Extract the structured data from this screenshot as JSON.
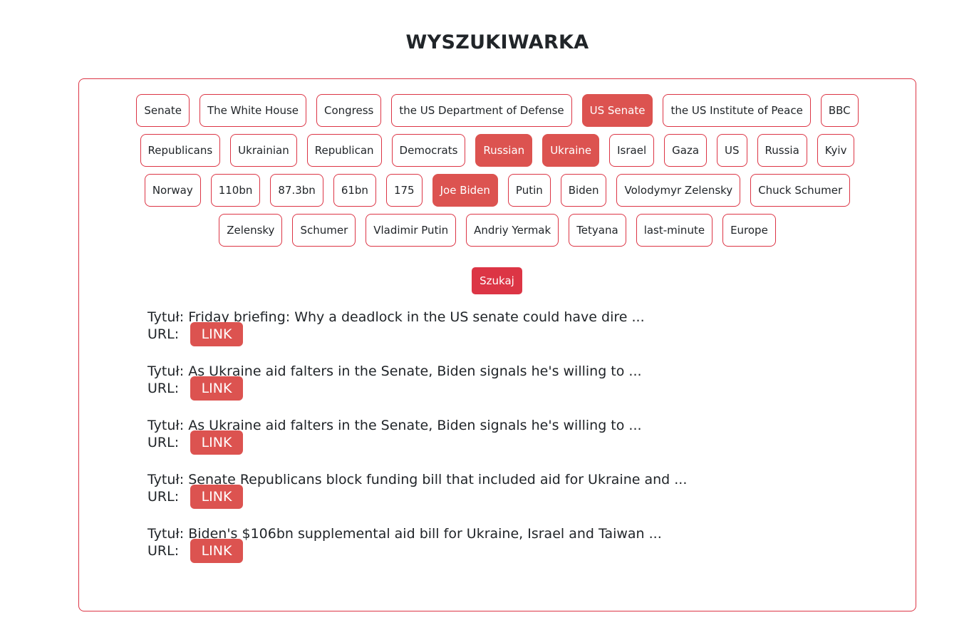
{
  "header": {
    "title": "WYSZUKIWARKA"
  },
  "tag_rows": [
    [
      {
        "label": "Senate",
        "active": false
      },
      {
        "label": "The White House",
        "active": false
      },
      {
        "label": "Congress",
        "active": false
      },
      {
        "label": "the US Department of Defense",
        "active": false
      },
      {
        "label": "US Senate",
        "active": true
      },
      {
        "label": "the US Institute of Peace",
        "active": false
      },
      {
        "label": "BBC",
        "active": false
      }
    ],
    [
      {
        "label": "Republicans",
        "active": false
      },
      {
        "label": "Ukrainian",
        "active": false
      },
      {
        "label": "Republican",
        "active": false
      },
      {
        "label": "Democrats",
        "active": false
      },
      {
        "label": "Russian",
        "active": true
      },
      {
        "label": "Ukraine",
        "active": true
      },
      {
        "label": "Israel",
        "active": false
      },
      {
        "label": "Gaza",
        "active": false
      },
      {
        "label": "US",
        "active": false
      },
      {
        "label": "Russia",
        "active": false
      },
      {
        "label": "Kyiv",
        "active": false
      }
    ],
    [
      {
        "label": "Norway",
        "active": false
      },
      {
        "label": "110bn",
        "active": false
      },
      {
        "label": "87.3bn",
        "active": false
      },
      {
        "label": "61bn",
        "active": false
      },
      {
        "label": "175",
        "active": false
      },
      {
        "label": "Joe Biden",
        "active": true
      },
      {
        "label": "Putin",
        "active": false
      },
      {
        "label": "Biden",
        "active": false
      },
      {
        "label": "Volodymyr Zelensky",
        "active": false
      },
      {
        "label": "Chuck Schumer",
        "active": false
      }
    ],
    [
      {
        "label": "Zelensky",
        "active": false
      },
      {
        "label": "Schumer",
        "active": false
      },
      {
        "label": "Vladimir Putin",
        "active": false
      },
      {
        "label": "Andriy Yermak",
        "active": false
      },
      {
        "label": "Tetyana",
        "active": false
      },
      {
        "label": "last-minute",
        "active": false
      },
      {
        "label": "Europe",
        "active": false
      }
    ]
  ],
  "search": {
    "button_label": "Szukaj"
  },
  "results": [
    {
      "title": "Tytuł: Friday briefing: Why a deadlock in the US senate could have dire ...",
      "url_label": "URL:",
      "link_label": "LINK"
    },
    {
      "title": "Tytuł: As Ukraine aid falters in the Senate, Biden signals he's willing to ...",
      "url_label": "URL:",
      "link_label": "LINK"
    },
    {
      "title": "Tytuł: As Ukraine aid falters in the Senate, Biden signals he's willing to ...",
      "url_label": "URL:",
      "link_label": "LINK"
    },
    {
      "title": "Tytuł: Senate Republicans block funding bill that included aid for Ukraine and ...",
      "url_label": "URL:",
      "link_label": "LINK"
    },
    {
      "title": "Tytuł: Biden's $106bn supplemental aid bill for Ukraine, Israel and Taiwan ...",
      "url_label": "URL:",
      "link_label": "LINK"
    }
  ],
  "colors": {
    "accent": "#dc3545",
    "active_tag": "#dc5350"
  }
}
